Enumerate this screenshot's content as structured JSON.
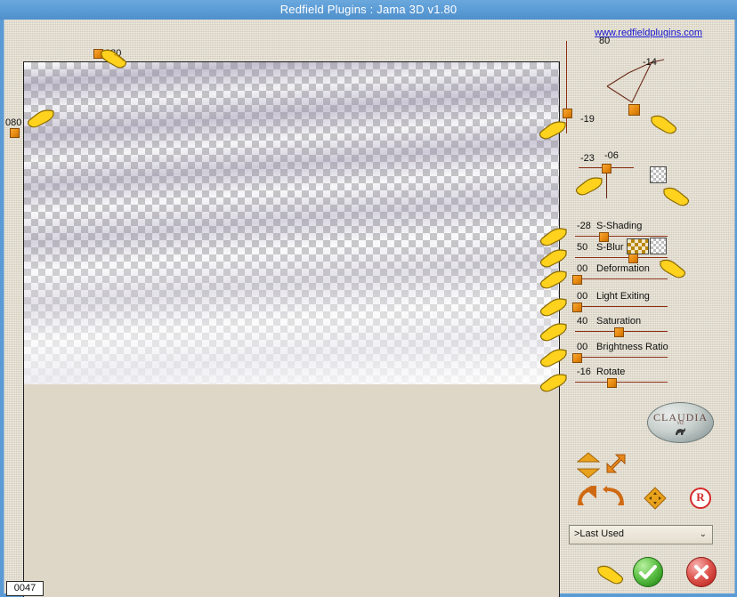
{
  "window": {
    "title": "Redfield Plugins : Jama 3D  v1.80",
    "titlebar_color": "#5b9bd5",
    "panel_color": "#ded7c7"
  },
  "link": {
    "label": "www.redfieldplugins.com",
    "color": "#1414cf"
  },
  "preview": {
    "top_marker_value": "080",
    "left_marker_value": "080",
    "status_value": "0047"
  },
  "vertical_slider": {
    "label": "80",
    "value": 80
  },
  "perspective_widget": {
    "corner_top_right_value": "-14",
    "corner_bottom_left_value": "-19"
  },
  "secondary_slider": {
    "left_value": "-23",
    "right_value": "-06"
  },
  "sliders": [
    {
      "value": "-28",
      "label": "S-Shading",
      "pos_pct": 30
    },
    {
      "value": "50",
      "label": "S-Blur",
      "pos_pct": 62
    },
    {
      "value": "00",
      "label": "Deformation",
      "pos_pct": 1
    },
    {
      "value": "00",
      "label": "Light Exiting",
      "pos_pct": 1
    },
    {
      "value": "40",
      "label": "Saturation",
      "pos_pct": 46
    },
    {
      "value": "00",
      "label": "Brightness Ratio",
      "pos_pct": 1
    },
    {
      "value": "-16",
      "label": "Rotate",
      "pos_pct": 38
    }
  ],
  "toggles": {
    "upper_checker": "checkerboard-toggle",
    "sblur_grid": "grid-pattern-toggle",
    "sblur_checker": "checkerboard-toggle"
  },
  "transform_tools": [
    {
      "name": "flip-vertical-icon"
    },
    {
      "name": "resize-diagonal-icon"
    },
    {
      "name": "rotate-left-icon"
    },
    {
      "name": "rotate-right-icon"
    },
    {
      "name": "move-icon"
    },
    {
      "name": "reset-icon",
      "label": "R"
    }
  ],
  "logo": {
    "title": "CLAUDIA",
    "subtitle": "VIZ"
  },
  "preset_dropdown": {
    "selected": ">Last Used",
    "arrow": "⌄"
  },
  "actions": {
    "ok_label": "OK",
    "cancel_label": "Cancel"
  }
}
